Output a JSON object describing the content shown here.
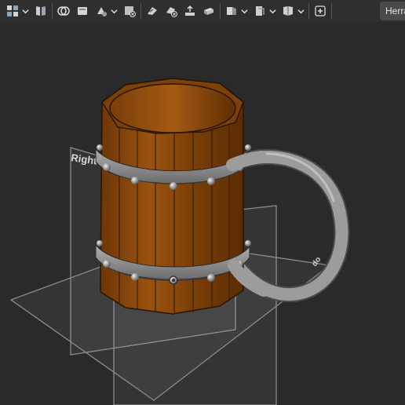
{
  "toolbar": {
    "tools": [
      {
        "name": "part-icon",
        "has_dropdown": true
      },
      {
        "name": "book-icon",
        "has_dropdown": false
      },
      {
        "name": "boolean-icon",
        "has_dropdown": false
      },
      {
        "name": "sketch-icon",
        "has_dropdown": false
      },
      {
        "name": "shapes-icon",
        "has_dropdown": true
      },
      {
        "name": "delete-shape-icon",
        "has_dropdown": false
      },
      {
        "name": "measure-icon",
        "has_dropdown": false
      },
      {
        "name": "remove-icon",
        "has_dropdown": false
      },
      {
        "name": "export-icon",
        "has_dropdown": false
      },
      {
        "name": "section-icon",
        "has_dropdown": false
      },
      {
        "name": "view-icon",
        "has_dropdown": true
      },
      {
        "name": "document-view-icon",
        "has_dropdown": true
      },
      {
        "name": "fit-all-icon",
        "has_dropdown": true
      },
      {
        "name": "add-view-icon",
        "has_dropdown": false
      }
    ],
    "workbench_label": "Herra"
  },
  "viewport": {
    "plane_labels": {
      "right": "Right",
      "top_partial": "do"
    },
    "colors": {
      "background": "#2a2a2a",
      "wood": "#8a4a12",
      "band": "#8c8c8c",
      "handle": "#9a9a9a"
    }
  }
}
